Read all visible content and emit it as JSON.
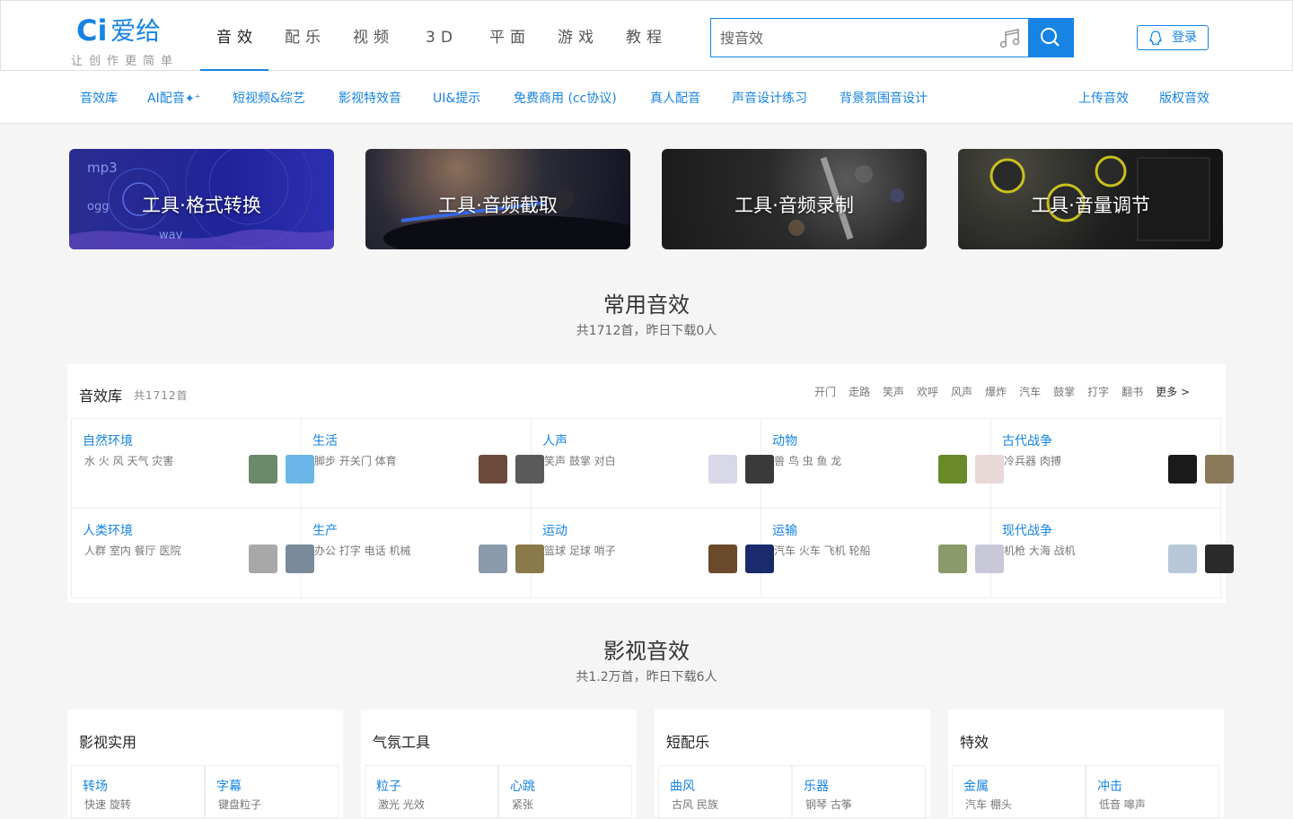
{
  "logo": {
    "mark": "Ci",
    "name": "爱给",
    "slogan": "让创作更简单"
  },
  "nav": [
    "音效",
    "配乐",
    "视频",
    "3D",
    "平面",
    "游戏",
    "教程"
  ],
  "nav_active": 0,
  "search": {
    "placeholder": "搜音效"
  },
  "login_label": "登录",
  "subnav": {
    "items": [
      "音效库",
      "AI配音",
      "短视频&综艺",
      "影视特效音",
      "UI&提示",
      "免费商用 (cc协议)",
      "真人配音",
      "声音设计练习",
      "背景氛围音设计"
    ],
    "ai_spark": "✦⁺",
    "right": [
      "上传音效",
      "版权音效"
    ]
  },
  "banners": [
    "工具·格式转换",
    "工具·音频截取",
    "工具·音频录制",
    "工具·音量调节"
  ],
  "banner1_deco": {
    "mp3": "mp3",
    "ogg": "ogg",
    "wav": "wav"
  },
  "section1": {
    "title": "常用音效",
    "subtitle": "共1712首，昨日下载0人",
    "card_title": "音效库",
    "card_count": "共1712首",
    "tags": [
      "开门",
      "走路",
      "笑声",
      "欢呼",
      "风声",
      "爆炸",
      "汽车",
      "鼓掌",
      "打字",
      "翻书"
    ],
    "more": "更多 >",
    "cells": [
      {
        "title": "自然环境",
        "desc": "水 火 风 天气 灾害",
        "c1": "#6a8a6a",
        "c2": "#6ab6e6"
      },
      {
        "title": "生活",
        "desc": "脚步 开关门 体育",
        "c1": "#6b4a3a",
        "c2": "#5a5a5a"
      },
      {
        "title": "人声",
        "desc": "笑声 鼓掌 对白",
        "c1": "#d8d8e8",
        "c2": "#3a3a3a"
      },
      {
        "title": "动物",
        "desc": "兽 鸟 虫 鱼 龙",
        "c1": "#6a8a2a",
        "c2": "#e8d8d8"
      },
      {
        "title": "古代战争",
        "desc": "冷兵器 肉搏",
        "c1": "#1a1a1a",
        "c2": "#8a7a5a"
      },
      {
        "title": "人类环境",
        "desc": "人群 室内 餐厅 医院",
        "c1": "#a8a8a8",
        "c2": "#7a8a9a"
      },
      {
        "title": "生产",
        "desc": "办公 打字 电话 机械",
        "c1": "#8a9aaa",
        "c2": "#8a7a4a"
      },
      {
        "title": "运动",
        "desc": "篮球 足球 哨子",
        "c1": "#6a4a2a",
        "c2": "#1a2a6a"
      },
      {
        "title": "运输",
        "desc": "汽车 火车 飞机 轮船",
        "c1": "#8a9a6a",
        "c2": "#c8c8d8"
      },
      {
        "title": "现代战争",
        "desc": "机枪 大海 战机",
        "c1": "#b8c8d8",
        "c2": "#2a2a2a"
      }
    ]
  },
  "section2": {
    "title": "影视音效",
    "subtitle": "共1.2万首，昨日下载6人",
    "cards": [
      {
        "title": "影视实用",
        "subs": [
          {
            "t": "转场",
            "d": "快速 旋转"
          },
          {
            "t": "字幕",
            "d": "键盘粒子"
          }
        ]
      },
      {
        "title": "气氛工具",
        "subs": [
          {
            "t": "粒子",
            "d": "激光 光效"
          },
          {
            "t": "心跳",
            "d": "紧张"
          }
        ]
      },
      {
        "title": "短配乐",
        "subs": [
          {
            "t": "曲风",
            "d": "古风 民族"
          },
          {
            "t": "乐器",
            "d": "钢琴 古筝"
          }
        ]
      },
      {
        "title": "特效",
        "subs": [
          {
            "t": "金属",
            "d": "汽车 棚头"
          },
          {
            "t": "冲击",
            "d": "低音 嗥声"
          }
        ]
      }
    ]
  }
}
